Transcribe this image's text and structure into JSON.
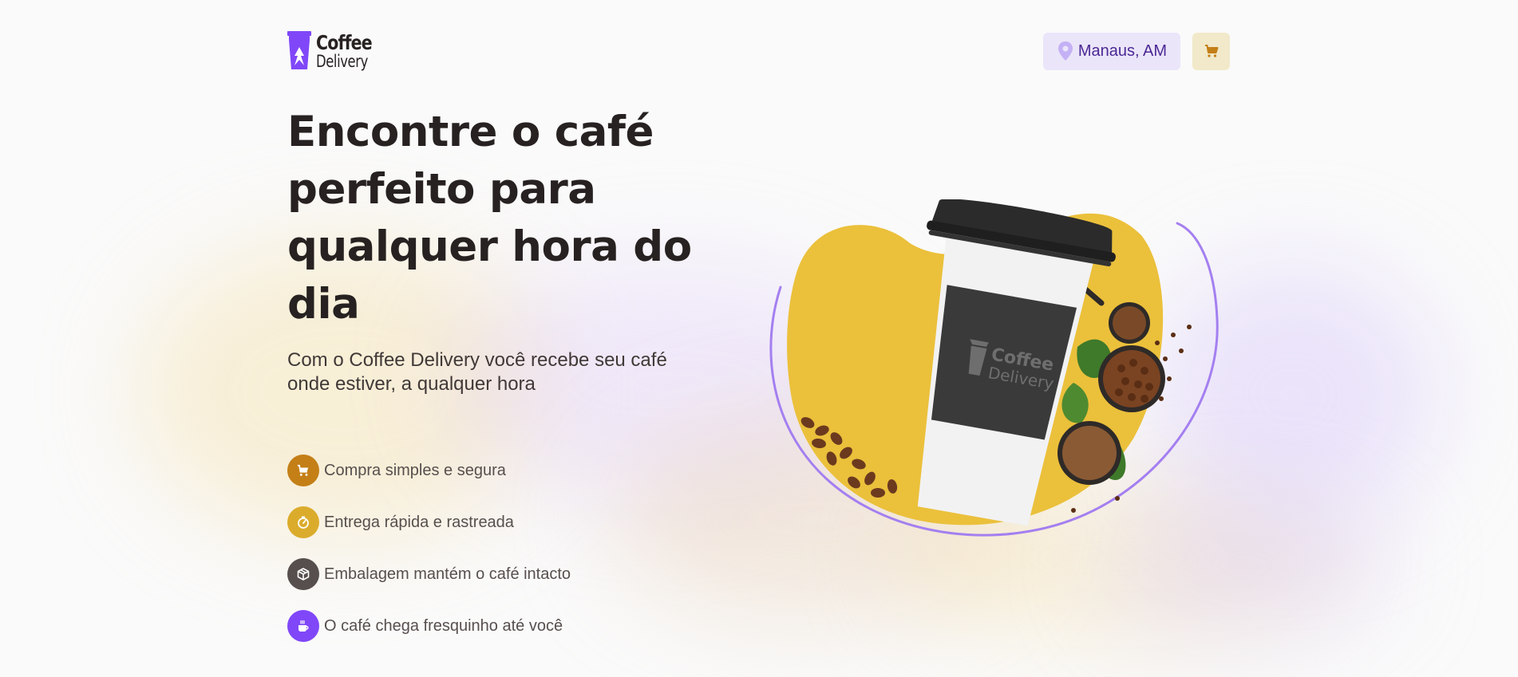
{
  "brand": {
    "logo_line1": "Coffee",
    "logo_line2": "Delivery"
  },
  "header": {
    "location_label": "Manaus, AM",
    "cart_icon": "cart-icon"
  },
  "hero": {
    "headline": "Encontre o café perfeito para qualquer hora do dia",
    "subtitle": "Com o Coffee Delivery você recebe seu café onde estiver, a qualquer hora",
    "features": [
      {
        "icon": "cart-icon",
        "label": "Compra simples e segura",
        "color": "#C47F17"
      },
      {
        "icon": "timer-icon",
        "label": "Entrega rápida e rastreada",
        "color": "#DBAC2C"
      },
      {
        "icon": "package-icon",
        "label": "Embalagem mantém o café intacto",
        "color": "#574F4D"
      },
      {
        "icon": "coffee-icon",
        "label": "O café chega fresquinho até você",
        "color": "#8047F8"
      }
    ],
    "illustration": {
      "cup_sleeve_line1": "Coffee",
      "cup_sleeve_line2": "Delivery"
    }
  },
  "colors": {
    "purple": "#8047F8",
    "purple_dark": "#4B2995",
    "purple_light": "#EBE5F9",
    "yellow": "#DBAC2C",
    "yellow_dark": "#C47F17",
    "yellow_light": "#F1E9C9",
    "blob_yellow": "#EBC03B",
    "base_title": "#272221"
  }
}
